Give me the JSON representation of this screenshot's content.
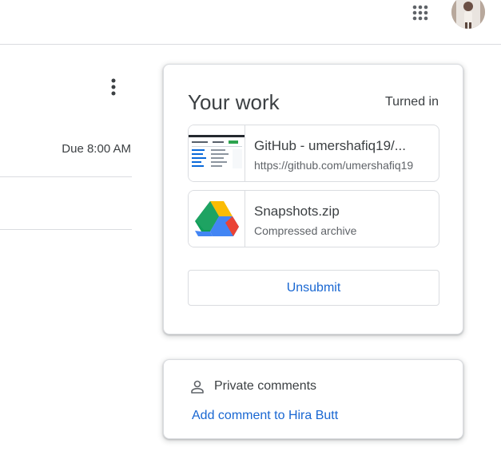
{
  "header": {
    "apps_icon": "google-apps-grid-icon",
    "avatar": "user-avatar"
  },
  "assignment": {
    "more_icon": "more-vert-icon",
    "due": "Due 8:00 AM"
  },
  "your_work": {
    "title": "Your work",
    "status": "Turned in",
    "attachments": [
      {
        "name": "GitHub - umershafiq19/...",
        "subtitle": "https://github.com/umershafiq19",
        "thumbnail": "webpage-screenshot-thumbnail"
      },
      {
        "name": "Snapshots.zip",
        "subtitle": "Compressed archive",
        "thumbnail": "google-drive-icon"
      }
    ],
    "unsubmit_label": "Unsubmit"
  },
  "private_comments": {
    "icon": "person-icon",
    "label": "Private comments",
    "add_label": "Add comment to Hira Butt"
  },
  "colors": {
    "accent_blue": "#1967d2",
    "text": "#3c4043",
    "secondary_text": "#5f6368",
    "border": "#dadce0"
  }
}
